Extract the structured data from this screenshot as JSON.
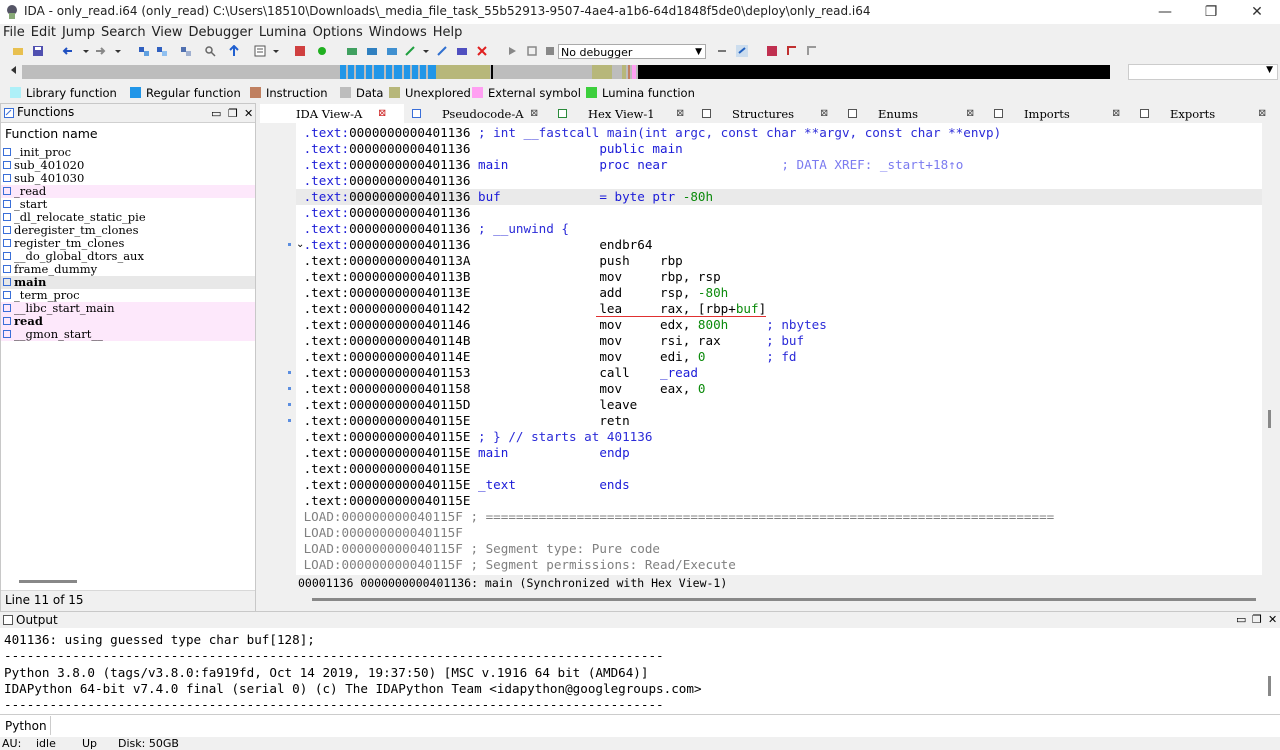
{
  "window": {
    "title": "IDA - only_read.i64 (only_read) C:\\Users\\18510\\Downloads\\_media_file_task_55b52913-9507-4ae4-a1b6-64d1848f5de0\\deploy\\only_read.i64",
    "controls": [
      "—",
      "❐",
      "✕"
    ]
  },
  "menu": [
    "File",
    "Edit",
    "Jump",
    "Search",
    "View",
    "Debugger",
    "Lumina",
    "Options",
    "Windows",
    "Help"
  ],
  "toolbar": {
    "debugger": "No debugger"
  },
  "legend": [
    {
      "label": "Library function",
      "color": "#aef0f8"
    },
    {
      "label": "Regular function",
      "color": "#2196e8"
    },
    {
      "label": "Instruction",
      "color": "#c08060"
    },
    {
      "label": "Data",
      "color": "#bdbdbd"
    },
    {
      "label": "Unexplored",
      "color": "#b7b77a"
    },
    {
      "label": "External symbol",
      "color": "#ff9ff2"
    },
    {
      "label": "Lumina function",
      "color": "#3ccf3c"
    }
  ],
  "functions": {
    "title": "Functions",
    "column": "Function name",
    "items": [
      {
        "name": "_init_proc",
        "type": "normal"
      },
      {
        "name": "sub_401020",
        "type": "normal"
      },
      {
        "name": "sub_401030",
        "type": "normal"
      },
      {
        "name": "_read",
        "type": "lib"
      },
      {
        "name": "_start",
        "type": "normal"
      },
      {
        "name": "_dl_relocate_static_pie",
        "type": "normal"
      },
      {
        "name": "deregister_tm_clones",
        "type": "normal"
      },
      {
        "name": "register_tm_clones",
        "type": "normal"
      },
      {
        "name": "__do_global_dtors_aux",
        "type": "normal"
      },
      {
        "name": "frame_dummy",
        "type": "normal"
      },
      {
        "name": "main",
        "type": "sel"
      },
      {
        "name": "_term_proc",
        "type": "normal"
      },
      {
        "name": "__libc_start_main",
        "type": "lib"
      },
      {
        "name": "read",
        "type": "libbold"
      },
      {
        "name": "__gmon_start__",
        "type": "lib"
      }
    ],
    "status": "Line 11 of 15"
  },
  "tabs": [
    {
      "label": "IDA View-A",
      "active": true
    },
    {
      "label": "Pseudocode-A",
      "active": false
    },
    {
      "label": "Hex View-1",
      "active": false
    },
    {
      "label": "Structures",
      "active": false
    },
    {
      "label": "Enums",
      "active": false
    },
    {
      "label": "Imports",
      "active": false
    },
    {
      "label": "Exports",
      "active": false
    }
  ],
  "code": {
    "seg": ".text:",
    "addrs": [
      "0000000000401136",
      "0000000000401136",
      "0000000000401136",
      "0000000000401136",
      "0000000000401136",
      "0000000000401136",
      "0000000000401136",
      "0000000000401136",
      "000000000040113A",
      "000000000040113B",
      "000000000040113E",
      "0000000000401142",
      "0000000000401146",
      "000000000040114B",
      "000000000040114E",
      "0000000000401153",
      "0000000000401158",
      "000000000040115D",
      "000000000040115E",
      "000000000040115E",
      "000000000040115E",
      "000000000040115E",
      "000000000040115E",
      "000000000040115E"
    ],
    "sig": "; int __fastcall main(int argc, const char **argv, const char **envp)",
    "public": "public main",
    "main_label": "main",
    "proc_near": "proc near",
    "xref": "; DATA XREF: _start+18↑o",
    "buf_label": "buf",
    "buf_def": "= byte ptr -80h",
    "unwind": "; __unwind {",
    "ins": [
      {
        "m": "endbr64",
        "o": "",
        "c": ""
      },
      {
        "m": "push",
        "o": "rbp",
        "c": ""
      },
      {
        "m": "mov",
        "o": "rbp, rsp",
        "c": ""
      },
      {
        "m": "add",
        "o": "rsp, -80h",
        "c": ""
      },
      {
        "m": "lea",
        "o": "rax, [rbp+buf]",
        "c": ""
      },
      {
        "m": "mov",
        "o": "edx, 800h",
        "c": "; nbytes"
      },
      {
        "m": "mov",
        "o": "rsi, rax",
        "c": "; buf"
      },
      {
        "m": "mov",
        "o": "edi, 0",
        "c": "; fd"
      },
      {
        "m": "call",
        "o": "_read",
        "c": ""
      },
      {
        "m": "mov",
        "o": "eax, 0",
        "c": ""
      },
      {
        "m": "leave",
        "o": "",
        "c": ""
      },
      {
        "m": "retn",
        "o": "",
        "c": ""
      }
    ],
    "end_unwind": "; } // starts at 401136",
    "endp": "endp",
    "text_label": "_text",
    "ends": "ends",
    "load_seg": "LOAD:",
    "load_addr": "000000000040115F",
    "load_sep": "; ===========================================================================",
    "seg_type": "; Segment type: Pure code",
    "seg_perm": "; Segment permissions: Read/Execute",
    "status": "00001136 0000000000401136: main (Synchronized with Hex View-1)"
  },
  "output": {
    "title": "Output",
    "lines": [
      "401136: using guessed type char buf[128];",
      "---------------------------------------------------------------------------------------",
      "Python 3.8.0 (tags/v3.8.0:fa919fd, Oct 14 2019, 19:37:50) [MSC v.1916 64 bit (AMD64)]",
      "IDAPython 64-bit v7.4.0 final (serial 0) (c) The IDAPython Team <idapython@googlegroups.com>",
      "---------------------------------------------------------------------------------------"
    ],
    "lang": "Python"
  },
  "statusbar": {
    "au": "AU:",
    "state": "idle",
    "dir": "Up",
    "disk": "Disk: 50GB"
  }
}
